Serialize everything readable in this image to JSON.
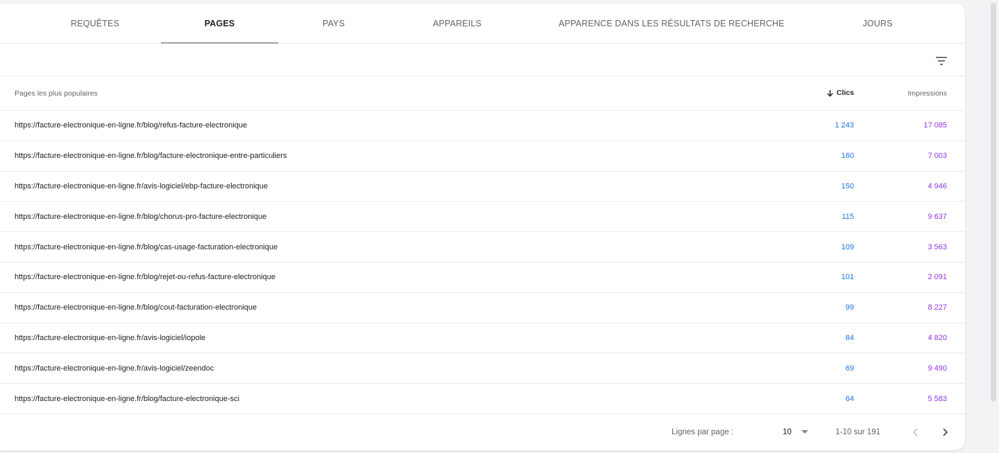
{
  "tabs": [
    {
      "label": "REQUÊTES"
    },
    {
      "label": "PAGES"
    },
    {
      "label": "PAYS"
    },
    {
      "label": "APPAREILS"
    },
    {
      "label": "APPARENCE DANS LES RÉSULTATS DE RECHERCHE"
    },
    {
      "label": "JOURS"
    }
  ],
  "active_tab": "PAGES",
  "filter_icon": "filter-list-icon",
  "table": {
    "col_pages": "Pages les plus populaires",
    "col_clics": "Clics",
    "col_impressions": "Impressions",
    "sort_icon": "arrow-downward-icon",
    "rows": [
      {
        "url": "https://facture-electronique-en-ligne.fr/blog/refus-facture-electronique",
        "clics": "1 243",
        "impressions": "17 085"
      },
      {
        "url": "https://facture-electronique-en-ligne.fr/blog/facture-electronique-entre-particuliers",
        "clics": "160",
        "impressions": "7 003"
      },
      {
        "url": "https://facture-electronique-en-ligne.fr/avis-logiciel/ebp-facture-electronique",
        "clics": "150",
        "impressions": "4 946"
      },
      {
        "url": "https://facture-electronique-en-ligne.fr/blog/chorus-pro-facture-electronique",
        "clics": "115",
        "impressions": "9 637"
      },
      {
        "url": "https://facture-electronique-en-ligne.fr/blog/cas-usage-facturation-electronique",
        "clics": "109",
        "impressions": "3 563"
      },
      {
        "url": "https://facture-electronique-en-ligne.fr/blog/rejet-ou-refus-facture-electronique",
        "clics": "101",
        "impressions": "2 091"
      },
      {
        "url": "https://facture-electronique-en-ligne.fr/blog/cout-facturation-electronique",
        "clics": "99",
        "impressions": "8 227"
      },
      {
        "url": "https://facture-electronique-en-ligne.fr/avis-logiciel/iopole",
        "clics": "84",
        "impressions": "4 820"
      },
      {
        "url": "https://facture-electronique-en-ligne.fr/avis-logiciel/zeendoc",
        "clics": "69",
        "impressions": "9 490"
      },
      {
        "url": "https://facture-electronique-en-ligne.fr/blog/facture-electronique-sci",
        "clics": "64",
        "impressions": "5 583"
      }
    ]
  },
  "pagination": {
    "rows_per_page_label": "Lignes par page :",
    "rows_per_page_value": "10",
    "range_text": "1-10 sur 191"
  },
  "colors": {
    "clics": "#1a73e8",
    "impressions": "#9334e6"
  }
}
